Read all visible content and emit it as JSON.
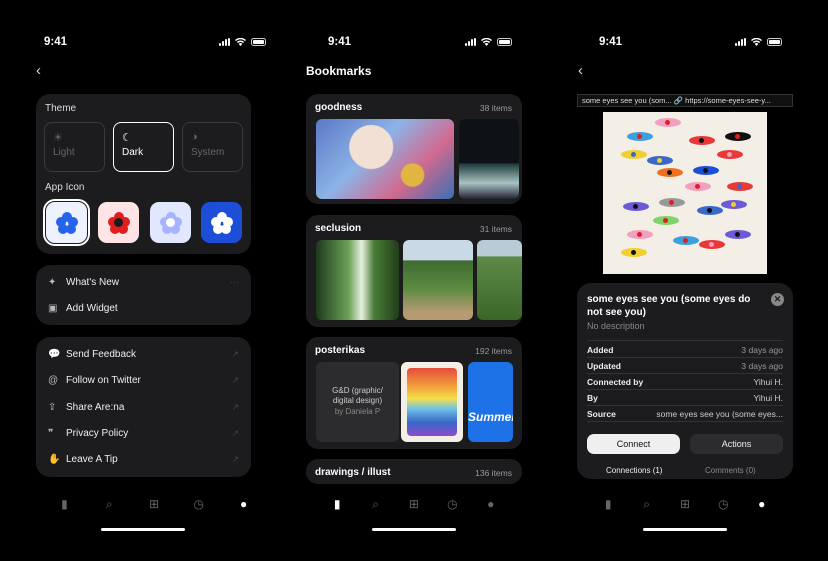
{
  "status": {
    "time": "9:41"
  },
  "settings": {
    "theme_label": "Theme",
    "themes": [
      {
        "label": "Light",
        "icon": "sun-icon"
      },
      {
        "label": "Dark",
        "icon": "moon-icon",
        "selected": true
      },
      {
        "label": "System",
        "icon": "half-circle-icon"
      }
    ],
    "app_icon_label": "App Icon",
    "menu1": [
      {
        "label": "What's New",
        "icon": "sparkle-icon"
      },
      {
        "label": "Add Widget",
        "icon": "widget-icon"
      }
    ],
    "menu2": [
      {
        "label": "Send Feedback",
        "icon": "chat-bubble-icon"
      },
      {
        "label": "Follow on Twitter",
        "icon": "at-icon"
      },
      {
        "label": "Share Are:na",
        "icon": "share-icon"
      },
      {
        "label": "Privacy Policy",
        "icon": "quote-icon"
      },
      {
        "label": "Leave A Tip",
        "icon": "hand-icon"
      }
    ]
  },
  "bookmarks": {
    "title": "Bookmarks",
    "collections": [
      {
        "name": "goodness",
        "count": "38 items"
      },
      {
        "name": "seclusion",
        "count": "31 items"
      },
      {
        "name": "posterikas",
        "count": "192 items",
        "card_text": "G&D (graphic/ digital design)",
        "card_by": "by Daniela P",
        "poster_text": "Summer"
      },
      {
        "name": "drawings / illust",
        "count": "136 items"
      }
    ]
  },
  "detail": {
    "url_bar": "some eyes see you (som...",
    "url_link": "https://some-eyes-see-y...",
    "title": "some eyes see you (some eyes do not see you)",
    "description": "No description",
    "fields": [
      {
        "key": "Added",
        "value": "3 days ago"
      },
      {
        "key": "Updated",
        "value": "3 days ago"
      },
      {
        "key": "Connected by",
        "value": "Yihui H."
      },
      {
        "key": "By",
        "value": "Yihui H."
      },
      {
        "key": "Source",
        "value": "some eyes see you (some eyes..."
      }
    ],
    "connect_label": "Connect",
    "actions_label": "Actions",
    "connections_tab": "Connections (1)",
    "comments_tab": "Comments (0)"
  }
}
